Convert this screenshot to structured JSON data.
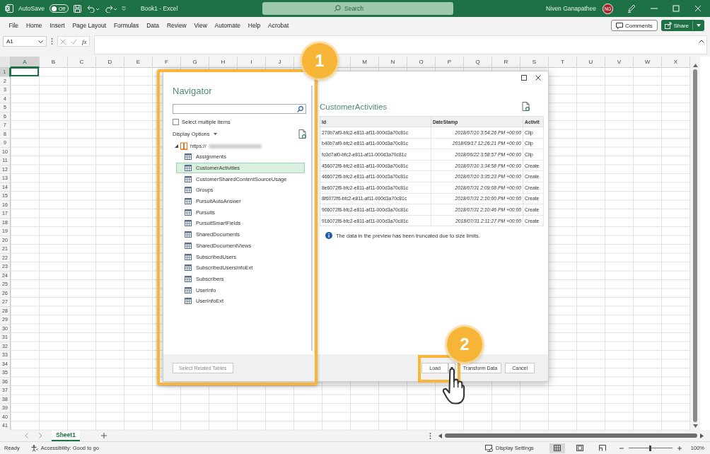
{
  "title_bar": {
    "autosave": {
      "label": "AutoSave",
      "on": false,
      "state_text": "Off"
    },
    "document_title": "Book1 - Excel",
    "search": {
      "placeholder": "Search"
    },
    "user_name": "Niven Ganapathee",
    "avatar_initials": "NG"
  },
  "menu": [
    "File",
    "Home",
    "Insert",
    "Page Layout",
    "Formulas",
    "Data",
    "Review",
    "View",
    "Automate",
    "Help",
    "Acrobat"
  ],
  "menu_buttons": {
    "comments": "Comments",
    "share": "Share"
  },
  "formula_bar": {
    "name_box": "A1",
    "fx": "fx"
  },
  "sheet": {
    "columns_before_badge": [
      "A",
      "B",
      "C",
      "D",
      "E",
      "F",
      "G",
      "H",
      "I",
      "J"
    ],
    "columns_after_badge": [
      "M",
      "N",
      "O",
      "P",
      "Q",
      "R",
      "S",
      "T",
      "U",
      "V",
      "W",
      "X"
    ],
    "rows": [
      "1",
      "2",
      "3",
      "4",
      "5",
      "6",
      "7",
      "8",
      "9",
      "10",
      "11",
      "12",
      "13",
      "14",
      "15",
      "16",
      "17",
      "18",
      "19",
      "20",
      "21",
      "22",
      "23",
      "24",
      "25",
      "26",
      "27",
      "28",
      "29",
      "30",
      "31",
      "32",
      "33",
      "34",
      "35",
      "36",
      "37",
      "38",
      "39",
      "40",
      "41"
    ]
  },
  "navigator": {
    "title": "Navigator",
    "select_multiple": {
      "label": "Select multiple items",
      "checked": false
    },
    "display_options": "Display Options",
    "tree": {
      "label": "https://",
      "expanded": true,
      "selected": false,
      "children": [
        {
          "label": "Assignments",
          "selected": false
        },
        {
          "label": "CustomerActivities",
          "selected": true
        },
        {
          "label": "CustomerSharedContentSourceUsage",
          "selected": false
        },
        {
          "label": "Groups",
          "selected": false
        },
        {
          "label": "PursuitAutoAnswer",
          "selected": false
        },
        {
          "label": "Pursuits",
          "selected": false
        },
        {
          "label": "PursuitSmartFields",
          "selected": false
        },
        {
          "label": "SharedDocuments",
          "selected": false
        },
        {
          "label": "SharedDocumentViews",
          "selected": false
        },
        {
          "label": "SubscribedUsers",
          "selected": false
        },
        {
          "label": "SubscribedUsersInfoExt",
          "selected": false
        },
        {
          "label": "Subscribers",
          "selected": false
        },
        {
          "label": "UserInfo",
          "selected": false
        },
        {
          "label": "UserInfoExt",
          "selected": false
        }
      ]
    },
    "related_button": {
      "label": "Select Related Tables",
      "disabled": true
    }
  },
  "preview": {
    "title": "CustomerActivities",
    "columns": [
      "Id",
      "DateStamp",
      "Activit"
    ],
    "rows": [
      [
        "270b7af0-bfc2-e811-af11-000d3a70c81c",
        "2018/07/10 3:54:26 PM +00:00",
        "Clip"
      ],
      [
        "b40b7af0-bfc2-e811-af11-000d3a70c81c",
        "2018/09/17 12:26:21 PM +00:00",
        "Clip"
      ],
      [
        "fc0d7af0-bfc2-e811-af11-000d3a70c81c",
        "2018/06/22 3:58:57 PM +00:00",
        "Clip"
      ],
      [
        "456072f6-bfc2-e811-af11-000d3a70c81c",
        "2018/07/10 3:34:58 PM +00:00",
        "Create"
      ],
      [
        "466072f6-bfc2-e811-af11-000d3a70c81c",
        "2018/07/10 3:35:23 PM +00:00",
        "Create"
      ],
      [
        "8e6072f6-bfc2-e811-af11-000d3a70c81c",
        "2018/07/31 2:09:08 PM +00:00",
        "Create"
      ],
      [
        "8f6072f6-bfc2-e811-af11-000d3a70c81c",
        "2018/07/31 2:10:00 PM +00:00",
        "Create"
      ],
      [
        "906072f6-bfc2-e811-af11-000d3a70c81c",
        "2018/07/31 2:10:46 PM +00:00",
        "Create"
      ],
      [
        "916072f6-bfc2-e811-af11-000d3a70c81c",
        "2018/07/31 2:11:27 PM +00:00",
        "Create"
      ]
    ],
    "notice": "The data in the preview has been truncated due to size limits."
  },
  "dialog_buttons": {
    "load": "Load",
    "transform": "Transform Data",
    "cancel": "Cancel"
  },
  "callouts": [
    "1",
    "2"
  ],
  "sheet_tabs": [
    {
      "label": "Sheet1",
      "selected": true
    }
  ],
  "status_bar": {
    "ready": "Ready",
    "accessibility": "Accessibility: Good to go",
    "display_settings": "Display Settings",
    "views": [
      {
        "kind": "normal",
        "selected": true
      },
      {
        "kind": "page-layout",
        "selected": false
      },
      {
        "kind": "page-break",
        "selected": false
      }
    ],
    "zoom": {
      "level": 0.5,
      "reading": "100%"
    }
  }
}
